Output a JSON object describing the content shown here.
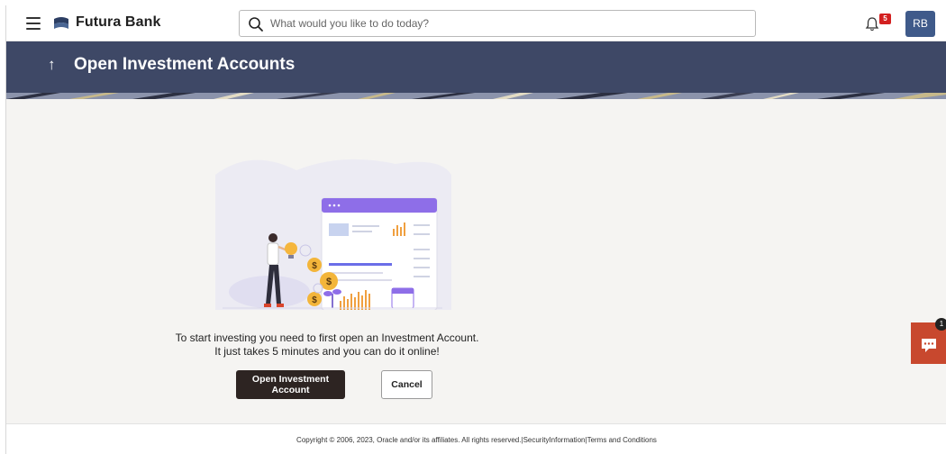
{
  "app": {
    "brand": "Futura Bank",
    "search_placeholder": "What would you like to do today?",
    "notification_count": "5",
    "user_initials": "RB"
  },
  "header": {
    "back_glyph": "↑",
    "title": "Open Investment Accounts"
  },
  "content": {
    "line1": "To start investing you need to first open an Investment Account.",
    "line2": "It just takes 5 minutes and you can do it online!",
    "primary_button": "Open Investment Account",
    "secondary_button": "Cancel"
  },
  "chat": {
    "badge": "1"
  },
  "footer": {
    "copyright": "Copyright © 2006, 2023, Oracle and/or its affiliates. All rights reserved.|",
    "security_link": "SecurityInformation",
    "separator": "|",
    "terms_link": "Terms and Conditions"
  },
  "colors": {
    "header_band": "#3e4866",
    "primary_button": "#2d2422",
    "chat_widget": "#c8482e",
    "badge": "#d32020",
    "avatar": "#3f5a8a"
  },
  "icons": [
    "hamburger-icon",
    "bank-logo-icon",
    "search-icon",
    "bell-icon",
    "back-arrow-icon",
    "chat-icon"
  ]
}
